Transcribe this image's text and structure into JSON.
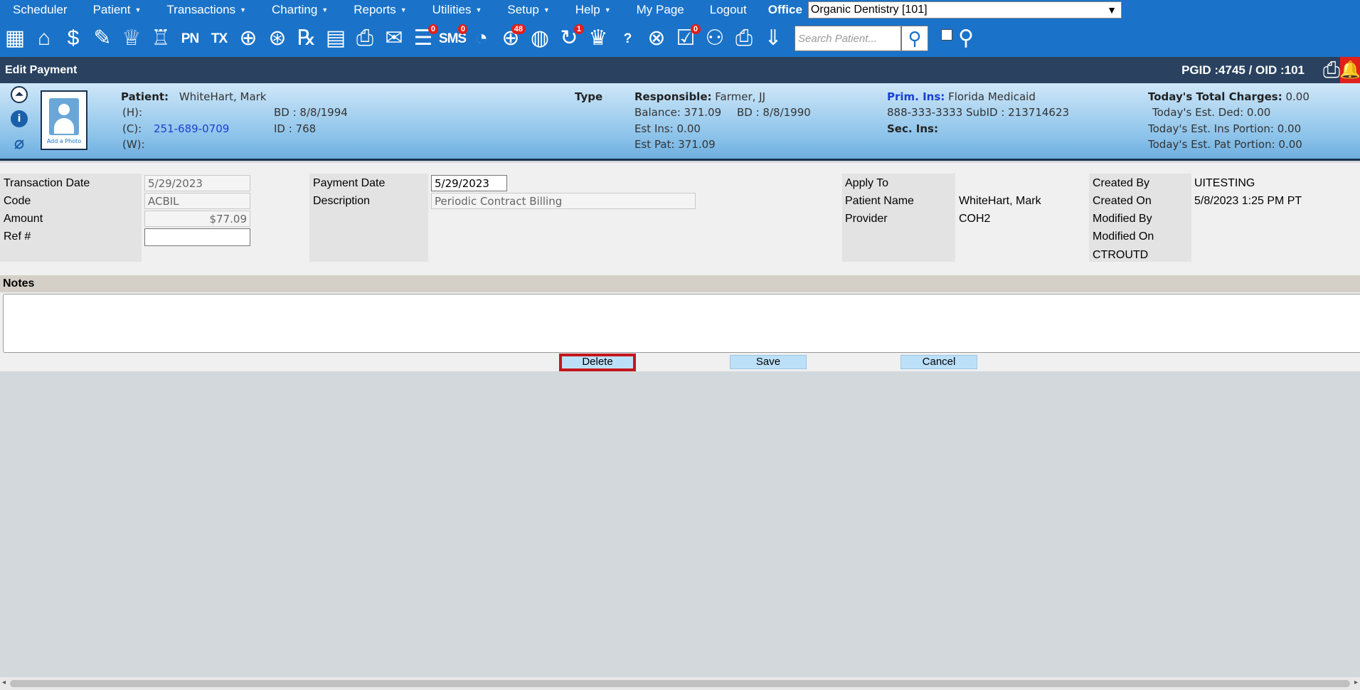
{
  "menu": {
    "items": [
      {
        "label": "Scheduler",
        "caret": false
      },
      {
        "label": "Patient",
        "caret": true
      },
      {
        "label": "Transactions",
        "caret": true
      },
      {
        "label": "Charting",
        "caret": true
      },
      {
        "label": "Reports",
        "caret": true
      },
      {
        "label": "Utilities",
        "caret": true
      },
      {
        "label": "Setup",
        "caret": true
      },
      {
        "label": "Help",
        "caret": true
      },
      {
        "label": "My Page",
        "caret": false
      },
      {
        "label": "Logout",
        "caret": false
      }
    ],
    "caret_glyph": "▼",
    "office_label": "Office",
    "office_value": "Organic Dentistry [101]"
  },
  "toolbar": {
    "tools": [
      {
        "name": "calendar-icon",
        "glyph": "▦"
      },
      {
        "name": "home-icon",
        "glyph": "⌂"
      },
      {
        "name": "dollar-icon",
        "glyph": "$"
      },
      {
        "name": "edit-notes-icon",
        "glyph": "✎"
      },
      {
        "name": "tooth-chart-icon",
        "glyph": "♕"
      },
      {
        "name": "perio-chart-icon",
        "glyph": "♖"
      },
      {
        "name": "progress-notes-icon",
        "glyph": "PN",
        "text": true
      },
      {
        "name": "treatment-plan-icon",
        "glyph": "TX",
        "text": true
      },
      {
        "name": "add-patient-icon",
        "glyph": "⊕"
      },
      {
        "name": "add-family-icon",
        "glyph": "⊛"
      },
      {
        "name": "prescription-icon",
        "glyph": "℞"
      },
      {
        "name": "document-icon",
        "glyph": "▤"
      },
      {
        "name": "scan-document-icon",
        "glyph": "⎙"
      },
      {
        "name": "mail-icon",
        "glyph": "✉"
      },
      {
        "name": "messages-icon",
        "glyph": "☰",
        "badge": "0"
      },
      {
        "name": "sms-icon",
        "glyph": "SMS",
        "text": true,
        "badge": "0"
      },
      {
        "name": "clock-icon",
        "glyph": "◔"
      },
      {
        "name": "online-patients-icon",
        "glyph": "⊕",
        "badge": "48"
      },
      {
        "name": "web-booking-icon",
        "glyph": "◍"
      },
      {
        "name": "recall-icon",
        "glyph": "↻",
        "badge": "1"
      },
      {
        "name": "tooth-icon",
        "glyph": "♛"
      },
      {
        "name": "tooth-help-icon",
        "glyph": "?",
        "text": true
      },
      {
        "name": "globe-pointer-icon",
        "glyph": "⊗"
      },
      {
        "name": "claims-icon",
        "glyph": "☑",
        "badge": "0"
      },
      {
        "name": "group-icon",
        "glyph": "⚇"
      },
      {
        "name": "printer-icon",
        "glyph": "⎙"
      },
      {
        "name": "collapse-down-icon",
        "glyph": "⇓"
      }
    ],
    "search_placeholder": "Search Patient...",
    "search_icon": "user-search-icon",
    "search_glyph": "⚲",
    "group_search_glyph": "⚲"
  },
  "titlebar": {
    "title": "Edit Payment",
    "ids": "PGID :4745  /  OID :101",
    "print_glyph": "⎙",
    "bell_glyph": "🔔"
  },
  "patient": {
    "icon_collapse": "⏶",
    "icon_info": "i",
    "icon_attach": "⌀",
    "photo_caption": "Add a Photo",
    "patient_label": "Patient:",
    "patient_name": "WhiteHart, Mark",
    "h_label": "(H):",
    "c_label": "(C):",
    "c_phone": "251-689-0709",
    "w_label": "(W):",
    "bd": "BD : 8/8/1994",
    "id": "ID : 768",
    "type_label": "Type",
    "responsible_label": "Responsible:",
    "responsible_name": "Farmer, JJ",
    "balance": "Balance: 371.09",
    "resp_bd": "BD : 8/8/1990",
    "est_ins": "Est Ins:  0.00",
    "est_pat": "Est Pat: 371.09",
    "prim_ins_label": "Prim. Ins:",
    "prim_ins_name": "Florida Medicaid",
    "prim_ins_phone": "888-333-3333 SubID : 213714623",
    "sec_ins_label": "Sec. Ins:",
    "total_charges_label": "Today's Total Charges:",
    "total_charges": "0.00",
    "est_ded": "Today's Est. Ded:    0.00",
    "est_ins_portion": "Today's Est. Ins Portion: 0.00",
    "est_pat_portion": "Today's Est. Pat Portion: 0.00"
  },
  "form": {
    "transaction_date_label": "Transaction Date",
    "transaction_date": "5/29/2023",
    "code_label": "Code",
    "code": "ACBIL",
    "amount_label": "Amount",
    "amount": "$77.09",
    "ref_label": "Ref #",
    "ref": "",
    "payment_date_label": "Payment Date",
    "payment_date": "5/29/2023",
    "description_label": "Description",
    "description": "Periodic Contract Billing",
    "apply_to_label": "Apply To",
    "patient_name_label": "Patient Name",
    "patient_name": "WhiteHart, Mark",
    "provider_label": "Provider",
    "provider": "COH2",
    "created_by_label": "Created By",
    "created_by": "UITESTING",
    "created_on_label": "Created On",
    "created_on": "5/8/2023 1:25 PM PT",
    "modified_by_label": "Modified By",
    "modified_on_label": "Modified On",
    "modified_by_user": "CTROUTD"
  },
  "notes": {
    "label": "Notes",
    "value": ""
  },
  "buttons": {
    "delete": "Delete",
    "save": "Save",
    "cancel": "Cancel"
  },
  "scroll": {
    "left": "◂",
    "right": "▸"
  }
}
